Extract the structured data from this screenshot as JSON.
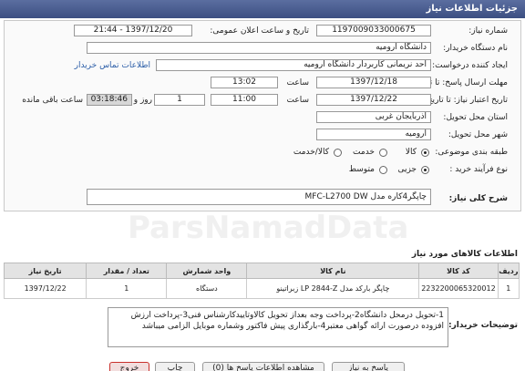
{
  "header": {
    "title": "جزئیات اطلاعات نیاز"
  },
  "form": {
    "need_number_label": "شماره نیاز:",
    "need_number": "1197009033000675",
    "announce_label": "تاریخ و ساعت اعلان عمومی:",
    "announce_value": "1397/12/20 - 21:44",
    "buyer_org_label": "نام دستگاه خریدار:",
    "buyer_org": "دانشگاه ارومیه",
    "creator_label": "ایجاد کننده درخواست:",
    "creator": "احد نریمانی کاربردار دانشگاه ارومیه",
    "buyer_contact_link": "اطلاعات تماس خریدار",
    "send_deadline_label": "مهلت ارسال پاسخ: تا تاریخ:",
    "send_date": "1397/12/18",
    "time_label": "ساعت",
    "send_time": "13:02",
    "validity_label": "تاریخ اعتبار نیاز: تا تاریخ:",
    "validity_date": "1397/12/22",
    "validity_time": "11:00",
    "days": "1",
    "days_label": "روز و",
    "remaining": "03:18:46",
    "remaining_label": "ساعت باقی مانده",
    "province_label": "استان محل تحویل:",
    "province": "آذربایجان غربی",
    "city_label": "شهر محل تحویل:",
    "city": "ارومیه",
    "category_label": "طبقه بندی موضوعی:",
    "category_options": [
      "کالا",
      "خدمت",
      "کالا/خدمت"
    ],
    "process_label": "نوع فرآیند خرید :",
    "process_options": [
      "جزیی",
      "متوسط"
    ],
    "general_desc_label": "شرح کلی نیاز:",
    "general_desc": "چاپگر4کاره مدل MFC-L2700 DW"
  },
  "items_section_title": "اطلاعات کالاهای مورد نیاز",
  "items_table": {
    "headers": [
      "ردیف",
      "کد کالا",
      "نام کالا",
      "واحد شمارش",
      "تعداد / مقدار",
      "تاریخ نیاز"
    ],
    "rows": [
      [
        "1",
        "2232200065320012",
        "چاپگر بارکد مدل LP 2844-Z زبراتینو",
        "دستگاه",
        "1",
        "1397/12/22"
      ]
    ]
  },
  "buyer_notes_label": "توضیحات خریدار:",
  "buyer_notes": "1-تحویل درمحل دانشگاه2-پرداخت وجه بعداز تحویل کالاوتاییدکارشناس فنی3-پرداخت ارزش افزوده درصورت ارائه گواهی معتبر4-بارگذاری پیش فاکتور وشماره موبایل الزامی میباشد",
  "buttons": {
    "back": "خروج",
    "print": "چاپ",
    "answer": "مشاهده اطلاعات پاسخ ها (0)",
    "reply": "پاسخ به نیاز"
  },
  "watermark": "ParsNamadData"
}
